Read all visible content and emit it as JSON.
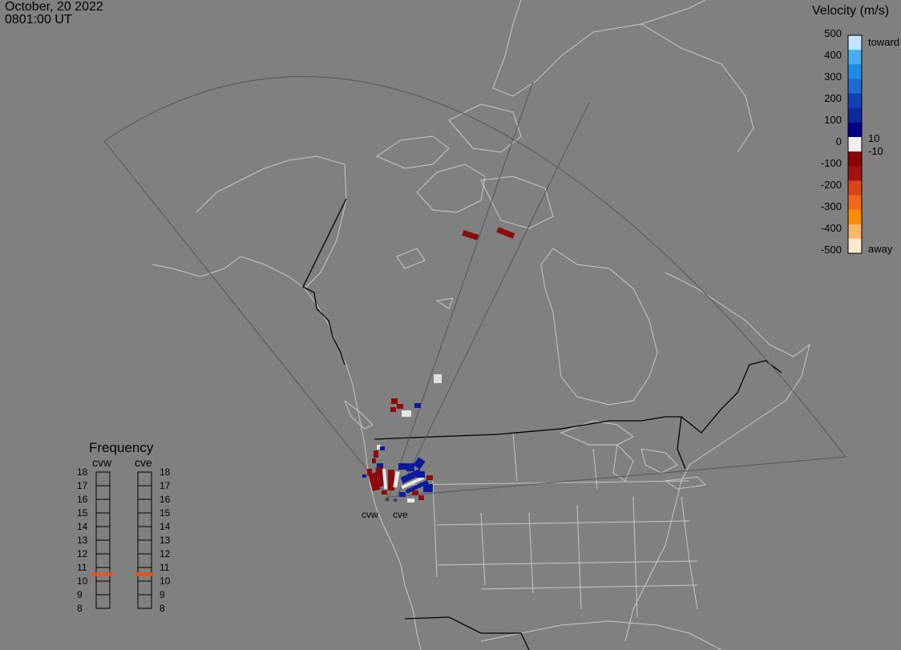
{
  "header": {
    "date": "October, 20 2022",
    "time": "0801:00 UT"
  },
  "velocity_scale": {
    "title": "Velocity (m/s)",
    "ticks": [
      "500",
      "400",
      "300",
      "200",
      "100",
      "0",
      "-100",
      "-200",
      "-300",
      "-400",
      "-500"
    ],
    "inner_ticks": [
      "10",
      "-10"
    ],
    "toward_label": "toward",
    "away_label": "away",
    "colors": [
      "#fde8d0",
      "#fdb869",
      "#ff8c00",
      "#f4681a",
      "#d84317",
      "#a21010",
      "#8b0000",
      "#f0f0f0",
      "#00008b",
      "#0a2a9c",
      "#1040b8",
      "#1e6bd6",
      "#1c8be8",
      "#49aef0",
      "#bfe6ff"
    ]
  },
  "frequency": {
    "title": "Frequency",
    "radars": [
      "cvw",
      "cve"
    ],
    "levels": [
      "18",
      "17",
      "16",
      "15",
      "14",
      "13",
      "12",
      "11",
      "10",
      "9",
      "8"
    ],
    "active_mhz": [
      10.5,
      10.5
    ],
    "indicator_color": "#e8541e"
  },
  "radar_sites": {
    "west": "cvw",
    "east": "cve"
  },
  "map_colors": {
    "background": "#808080",
    "coastline": "#c8c8c8",
    "border": "#000000",
    "fov": "#5a5a5a",
    "toward": "#0a1a9a",
    "away": "#8b0a0a",
    "low": "#e8e8e8"
  }
}
